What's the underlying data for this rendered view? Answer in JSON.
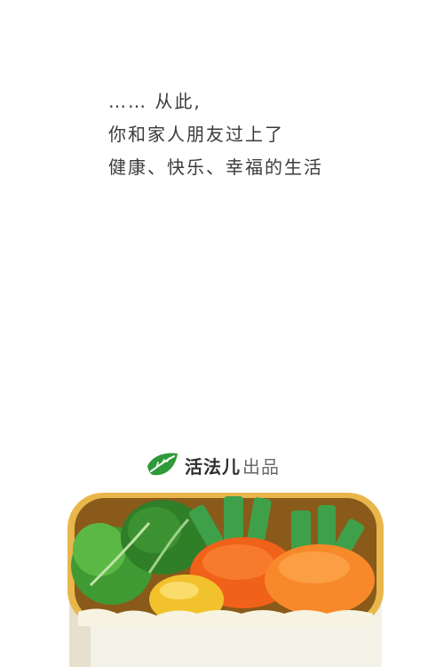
{
  "tagline": {
    "lines": [
      "…… 从此,",
      "你和家人朋友过上了",
      "健康、快乐、幸福的生活"
    ]
  },
  "brand": {
    "icon": "leaf-icon",
    "name": "活法儿",
    "suffix": "出品",
    "color": "#2e9a3a"
  },
  "illustration": {
    "subject": "bento-box",
    "colors": {
      "box": "#e8b64a",
      "leaf_green": "#3f9a34",
      "carrot": "#f47a22",
      "potato": "#f2c22e"
    }
  }
}
